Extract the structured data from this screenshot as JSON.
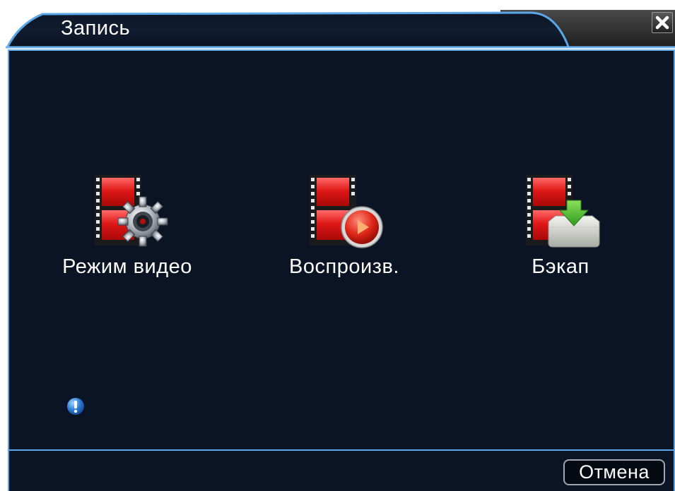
{
  "window": {
    "title": "Запись"
  },
  "menu": {
    "items": [
      {
        "label": "Режим видео",
        "icon": "film-gear-icon"
      },
      {
        "label": "Воспроизв.",
        "icon": "film-play-icon"
      },
      {
        "label": "Бэкап",
        "icon": "film-download-icon"
      }
    ]
  },
  "footer": {
    "cancel_label": "Отмена"
  },
  "colors": {
    "panel_background": "#0b1424",
    "border_accent": "#5aa6e6",
    "text": "#ffffff",
    "title_tab": "#1a2840"
  }
}
